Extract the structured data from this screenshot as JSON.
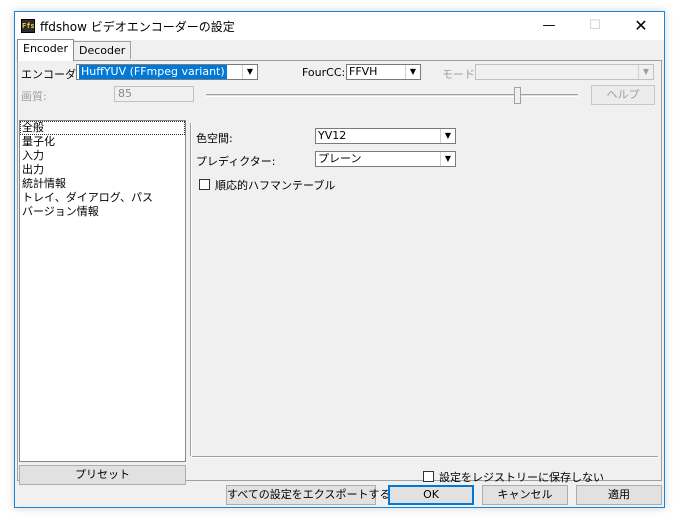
{
  "window": {
    "title": "ffdshow ビデオエンコーダーの設定",
    "icon": "ffdshow-app-icon",
    "icon_text": "Ffs"
  },
  "titlebar": {
    "minimize": "—",
    "maximize": "☐",
    "close": "✕"
  },
  "tabs": [
    {
      "label": "Encoder",
      "active": true
    },
    {
      "label": "Decoder",
      "active": false
    }
  ],
  "encoder": {
    "label": "エンコーダ",
    "value": "HuffYUV (FFmpeg variant)"
  },
  "fourcc": {
    "label": "FourCC:",
    "value": "FFVH"
  },
  "mode": {
    "label": "モード:",
    "value": ""
  },
  "quality": {
    "label": "画質:",
    "value": "85"
  },
  "help_button": "ヘルプ",
  "sidebar": {
    "items": [
      "全般",
      "量子化",
      "入力",
      "出力",
      "統計情報",
      "トレイ、ダイアログ、パス",
      "バージョン情報"
    ],
    "selected": 0
  },
  "preset_button": "プリセット",
  "general": {
    "colorspace": {
      "label": "色空間:",
      "value": "YV12"
    },
    "predictor": {
      "label": "プレディクター:",
      "value": "プレーン"
    },
    "adaptive_huffman": {
      "label": "順応的ハフマンテーブル",
      "checked": false
    }
  },
  "no_registry": {
    "label": "設定をレジストリーに保存しない",
    "checked": false
  },
  "footer": {
    "export_all": "すべての設定をエクスポートする",
    "ok": "OK",
    "cancel": "キャンセル",
    "apply": "適用"
  },
  "icons": {
    "dropdown": "▼"
  }
}
